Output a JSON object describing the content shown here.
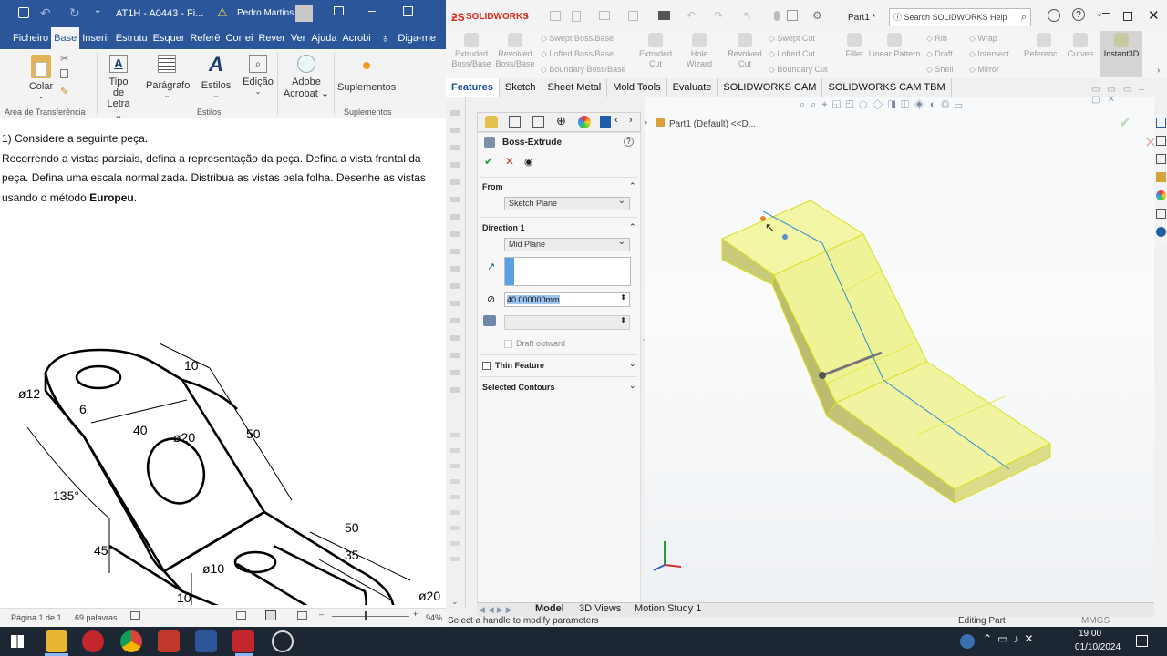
{
  "word": {
    "title": "AT1H - A0443 - Fi...",
    "user": "Pedro Martins",
    "tabs": [
      "Ficheiro",
      "Base",
      "Inserir",
      "Estrutu",
      "Esquer",
      "Referê",
      "Correi",
      "Rever",
      "Ver",
      "Ajuda",
      "Acrobi"
    ],
    "tell_me": "Diga-me",
    "ribbon": {
      "paste": "Colar",
      "font": [
        "Tipo de",
        "Letra"
      ],
      "paragraph": "Parágrafo",
      "styles": "Estilos",
      "editing": "Edição",
      "acrobat": [
        "Adobe",
        "Acrobat"
      ],
      "addins": "Suplementos",
      "group_clipboard": "Área de Transferência",
      "group_styles": "Estilos",
      "group_addins": "Suplementos"
    },
    "doc": {
      "line1": "1)  Considere a seguinte peça.",
      "line2": "Recorrendo a vistas parciais, defina a representação da peça. Defina a vista frontal da",
      "line3": "peça. Defina uma escala normalizada. Distribua as vistas pela folha. Desenhe as vistas",
      "line4a": "usando o método ",
      "line4b": "Europeu",
      "line4c": "."
    },
    "drawing": {
      "d12": "ø12",
      "d6": "6",
      "d10top": "10",
      "d40": "40",
      "d20": "ø20",
      "d50a": "50",
      "d135": "135°",
      "d45": "45°",
      "d50b": "50",
      "d35": "35",
      "d10b": "ø10",
      "d10c": "10",
      "d20b": "ø20"
    },
    "status": {
      "page": "Página 1 de 1",
      "words": "69 palavras",
      "zoom": "94%"
    }
  },
  "sw": {
    "logo": "SOLIDWORKS",
    "part": "Part1 *",
    "search": "Search SOLIDWORKS Help",
    "cmd": {
      "extruded_boss": [
        "Extruded",
        "Boss/Base"
      ],
      "revolved_boss": [
        "Revolved",
        "Boss/Base"
      ],
      "swept_boss": "Swept Boss/Base",
      "lofted_boss": "Lofted Boss/Base",
      "boundary_boss": "Boundary Boss/Base",
      "extruded_cut": [
        "Extruded",
        "Cut"
      ],
      "hole_wizard": "Hole Wizard",
      "revolved_cut": [
        "Revolved",
        "Cut"
      ],
      "swept_cut": "Swept Cut",
      "lofted_cut": "Lofted Cut",
      "boundary_cut": "Boundary Cut",
      "fillet": "Fillet",
      "linear_pattern": "Linear Pattern",
      "rib": "Rib",
      "draft": "Draft",
      "shell": "Shell",
      "wrap": "Wrap",
      "intersect": "Intersect",
      "mirror": "Mirror",
      "reference": "Referenc...",
      "curves": "Curves",
      "instant3d": "Instant3D"
    },
    "tabs": [
      "Features",
      "Sketch",
      "Sheet Metal",
      "Mold Tools",
      "Evaluate",
      "SOLIDWORKS CAM",
      "SOLIDWORKS CAM TBM"
    ],
    "pm": {
      "title": "Boss-Extrude",
      "from_label": "From",
      "from_value": "Sketch Plane",
      "dir1_label": "Direction 1",
      "dir1_value": "Mid Plane",
      "depth": "40.000000mm",
      "draft_outward": "Draft outward",
      "thin": "Thin Feature",
      "contours": "Selected Contours"
    },
    "tree": "Part1 (Default) <<D...",
    "btabs": [
      "Model",
      "3D Views",
      "Motion Study 1"
    ],
    "status_left": "Select a handle to modify parameters",
    "status_mid": "Editing Part",
    "status_right": "MMGS"
  },
  "taskbar": {
    "time": "19:00",
    "date": "01/10/2024"
  }
}
